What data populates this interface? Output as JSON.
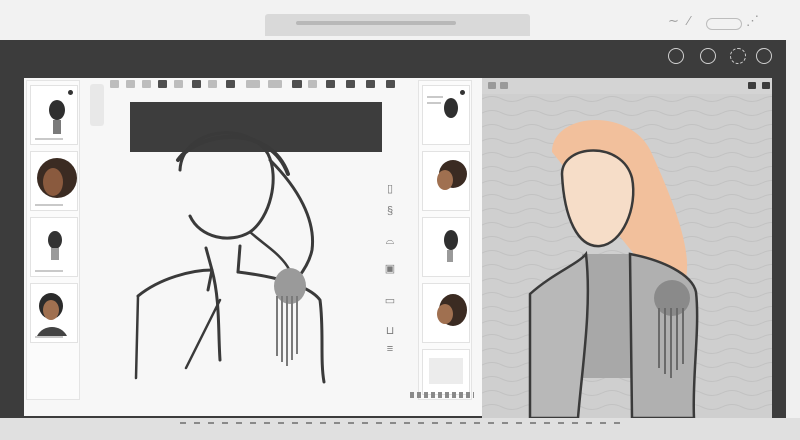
{
  "window": {
    "colors": {
      "frame": "#3c3c3c",
      "workspace": "#f7f7f7",
      "preview": "#cfcfcf",
      "accent_hair": "#f2c09c"
    }
  },
  "header_buttons": [
    {
      "icon": "circle-icon"
    },
    {
      "icon": "circle-icon"
    },
    {
      "icon": "history-icon"
    },
    {
      "icon": "share-icon"
    }
  ],
  "toolbar": {
    "tools": [
      "brush-icon",
      "eraser-icon",
      "select-icon",
      "lasso-icon",
      "fill-icon",
      "eyedropper-icon",
      "text-icon",
      "shape-icon",
      "layer-icon",
      "grid-icon",
      "zoom-icon",
      "hand-icon",
      "undo-icon",
      "redo-icon",
      "crop-icon",
      "settings-icon"
    ]
  },
  "vertical_tools": [
    "adjust-icon",
    "filter-icon",
    "cloud-icon",
    "image-icon",
    "frame-icon",
    "cup-icon",
    "stack-icon"
  ],
  "left_thumbnails": [
    {
      "name": "portrait-sketch-1"
    },
    {
      "name": "portrait-dark-hair"
    },
    {
      "name": "portrait-sketch-2"
    },
    {
      "name": "portrait-man"
    }
  ],
  "right_thumbnails": [
    {
      "name": "portrait-sketch-3"
    },
    {
      "name": "portrait-profile"
    },
    {
      "name": "portrait-sketch-4"
    },
    {
      "name": "portrait-curly"
    }
  ]
}
